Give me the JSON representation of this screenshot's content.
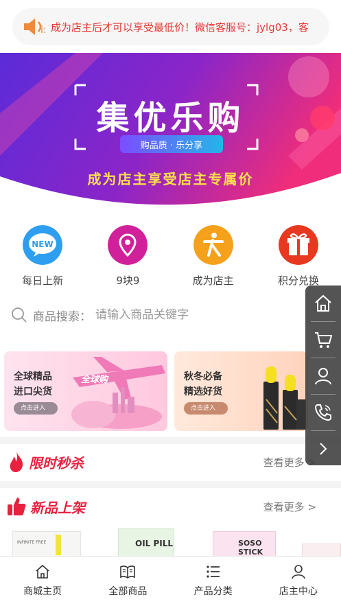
{
  "notice": {
    "text": "成为店主后才可以享受最低价！微信客服号：jylg03，客"
  },
  "hero": {
    "title": "集优乐购",
    "tagline": "购品质 · 乐分享",
    "slogan": "成为店主享受店主专属价"
  },
  "quick": [
    {
      "label": "每日上新",
      "badge": "NEW"
    },
    {
      "label": "9块9"
    },
    {
      "label": "成为店主"
    },
    {
      "label": "积分兑换"
    }
  ],
  "search": {
    "label": "商品搜索：",
    "placeholder": "请输入商品关键字"
  },
  "promos": [
    {
      "line1": "全球精品",
      "line2": "进口尖货",
      "button": "点击进入",
      "badge": "全球购"
    },
    {
      "line1": "秋冬必备",
      "line2": "精选好货",
      "button": "点击进入"
    }
  ],
  "sections": {
    "flash": {
      "title": "限时秒杀",
      "more": "查看更多 >"
    },
    "new": {
      "title": "新品上架",
      "more": "查看更多 >"
    }
  },
  "products": [
    {
      "label": "INFINITE FREE"
    },
    {
      "label": "OIL PILL"
    },
    {
      "label": "SOSO STICK"
    }
  ],
  "side_menu": [
    "home-icon",
    "cart-icon",
    "user-icon",
    "phone-icon",
    "arrow-right-icon"
  ],
  "tabs": [
    {
      "label": "商城主页"
    },
    {
      "label": "全部商品"
    },
    {
      "label": "产品分类"
    },
    {
      "label": "店主中心"
    }
  ],
  "colors": {
    "accent": "#e8213f",
    "notice_text": "#e53935",
    "hero_left": "#5b2bd8",
    "hero_right": "#ef2d7a"
  }
}
